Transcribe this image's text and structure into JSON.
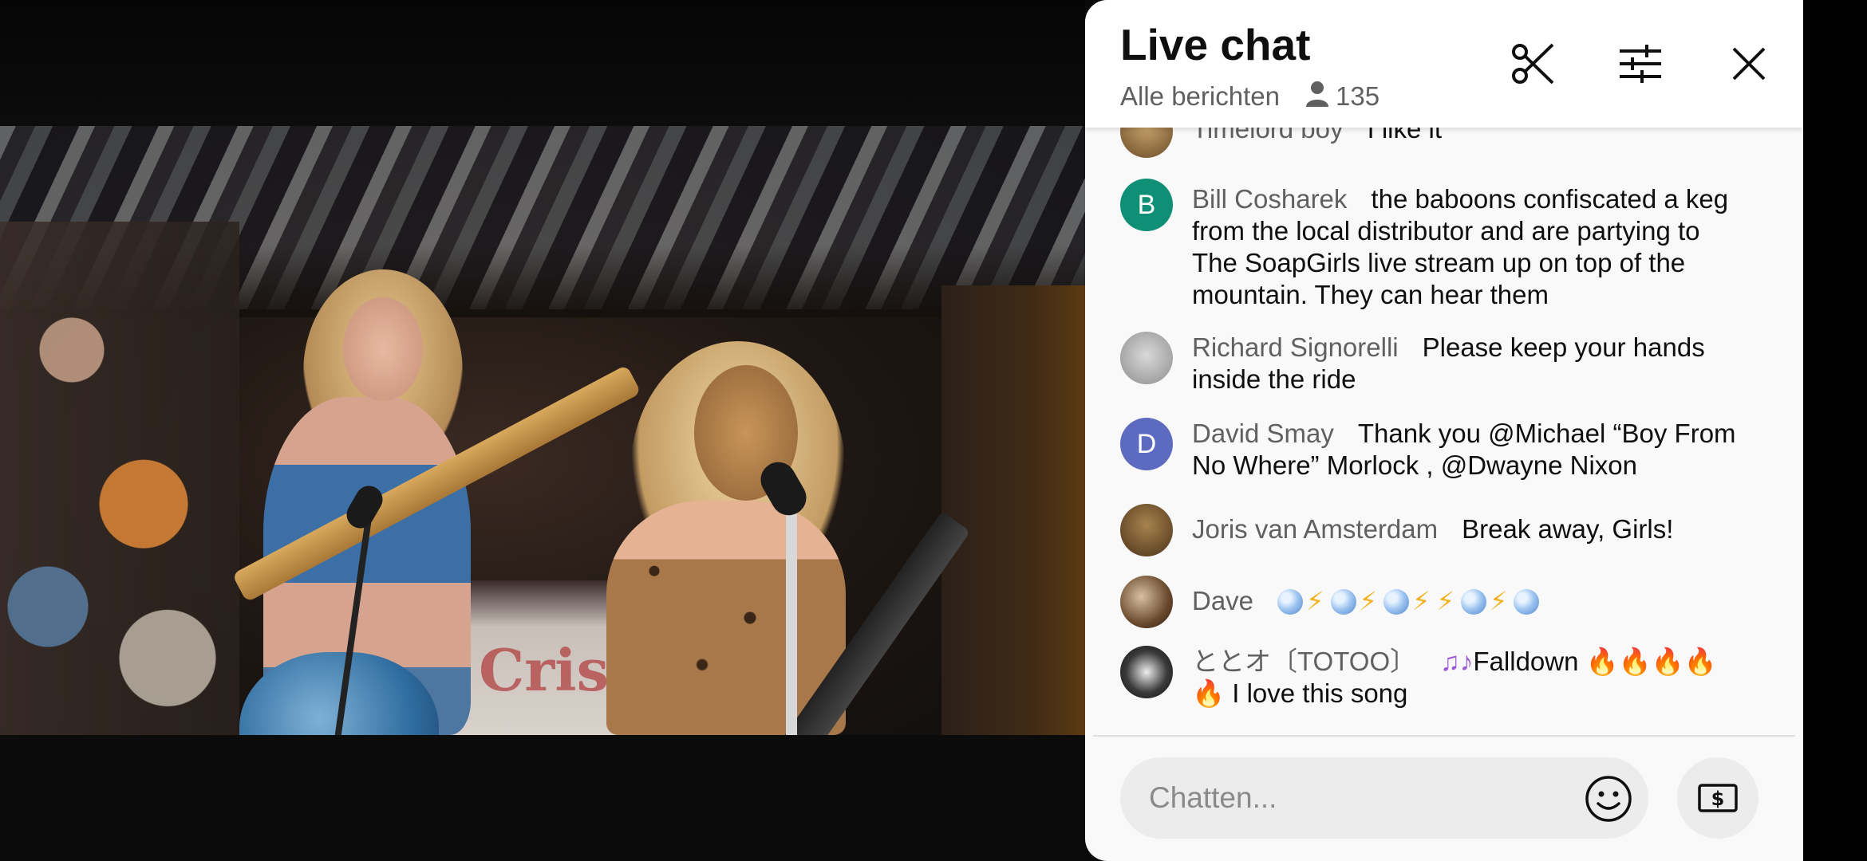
{
  "chat": {
    "title": "Live chat",
    "filter_label": "Alle berichten",
    "viewer_count": "135",
    "input_placeholder": "Chatten...",
    "accent_color": "#0f0f0f"
  },
  "messages": [
    {
      "author": "Timelord boy",
      "text": "I like it",
      "avatar_type": "image"
    },
    {
      "author": "Bill Cosharek",
      "text": "the baboons confiscated a keg from the local distributor and are partying to The SoapGirls live stream up on top of the mountain. They can hear them",
      "avatar_type": "letter",
      "avatar_letter": "B",
      "avatar_color": "#0f8f76"
    },
    {
      "author": "Richard Signorelli",
      "text": "Please keep your hands inside the ride",
      "avatar_type": "image"
    },
    {
      "author": "David Smay",
      "text": "Thank you @Michael “Boy From No Where” Morlock , @Dwayne Nixon",
      "avatar_type": "letter",
      "avatar_letter": "D",
      "avatar_color": "#5c6bc0"
    },
    {
      "author": "Joris van Amsterdam",
      "text": "Break away, Girls!",
      "avatar_type": "image"
    },
    {
      "author": "Dave",
      "text": "",
      "avatar_type": "image"
    },
    {
      "author": "ととオ〔TOTOO〕",
      "text_main": "Falldown",
      "text_end": "I love this song",
      "avatar_type": "image"
    }
  ],
  "video": {
    "banner_text": "Crispy"
  }
}
